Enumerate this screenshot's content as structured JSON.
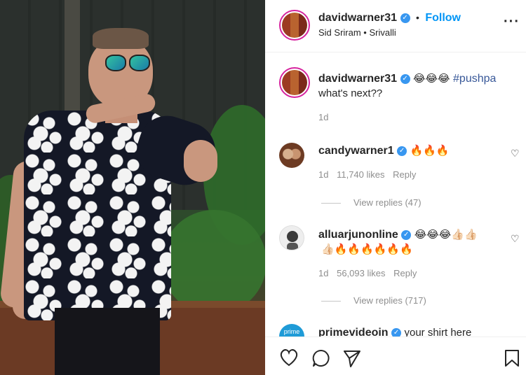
{
  "header": {
    "username": "davidwarner31",
    "separator": "•",
    "follow_label": "Follow",
    "audio": "Sid Sriram • Srivalli",
    "more_icon": "more-horizontal-icon"
  },
  "caption": {
    "username": "davidwarner31",
    "emojis": "😂😂😂",
    "hashtag": "#pushpa",
    "text": "what's next??",
    "time": "1d"
  },
  "comments": [
    {
      "username": "candywarner1",
      "text": "🔥🔥🔥",
      "time": "1d",
      "likes": "11,740 likes",
      "reply_label": "Reply",
      "view_replies": "View replies (47)"
    },
    {
      "username": "alluarjunonline",
      "text_line1": "😂😂😂👍🏻👍🏻",
      "text_line2": "👍🏻🔥🔥🔥🔥🔥🔥",
      "time": "1d",
      "likes": "56,093 likes",
      "reply_label": "Reply",
      "view_replies": "View replies (717)"
    },
    {
      "username": "primevideoin",
      "text": "your shirt here",
      "avatar_label": "prime"
    }
  ],
  "actions": {
    "like_icon": "heart-icon",
    "comment_icon": "comment-icon",
    "share_icon": "send-icon",
    "save_icon": "bookmark-icon"
  },
  "colors": {
    "follow": "#0095f6",
    "verified": "#3897f0",
    "hashtag": "#385898",
    "muted": "#8e8e8e"
  }
}
